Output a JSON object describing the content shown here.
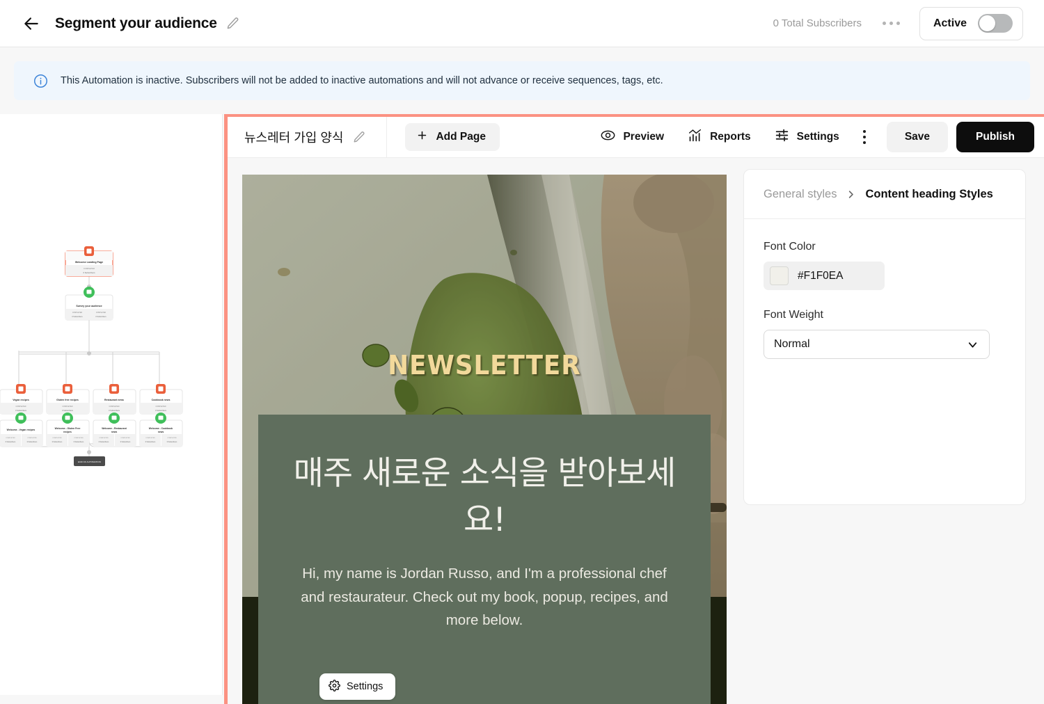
{
  "topbar": {
    "back_icon": "arrow-left-icon",
    "title": "Segment your audience",
    "edit_icon": "pencil-icon",
    "subscribers": "0 Total Subscribers",
    "more_icon": "more-horizontal-icon",
    "toggle_label": "Active",
    "toggle_on": false
  },
  "banner": {
    "icon": "info-icon",
    "text": "This Automation is inactive. Subscribers will not be added to inactive automations and will not advance or receive sequences, tags, etc.",
    "bg": "#eff6fd",
    "accent": "#3b83d8"
  },
  "flow": {
    "nodes": [
      {
        "label": "Welcome Landing Page",
        "meta1": "COMPLETED",
        "meta2": "0 Subscribers",
        "kind": "page",
        "selected": true
      },
      {
        "label": "Survey your audience",
        "meta1": "COMPLETED",
        "meta2": "0 Subscribers",
        "kind": "survey"
      },
      {
        "label": "Vegan recipes",
        "meta1": "COMPLETED",
        "meta2": "0 Subscribers",
        "kind": "page"
      },
      {
        "label": "Gluten free recipes",
        "meta1": "COMPLETED",
        "meta2": "0 Subscribers",
        "kind": "page"
      },
      {
        "label": "Restaurant news",
        "meta1": "COMPLETED",
        "meta2": "0 Subscribers",
        "kind": "page"
      },
      {
        "label": "Cookbook news",
        "meta1": "COMPLETED",
        "meta2": "0 Subscribers",
        "kind": "page"
      },
      {
        "label": "Welcome - Vegan recipes",
        "meta1": "COMPLETED",
        "meta2": "0 Subscribers",
        "kind": "email"
      },
      {
        "label": "Welcome - Gluten Free recipes",
        "meta1": "COMPLETED",
        "meta2": "0 Subscribers",
        "kind": "email"
      },
      {
        "label": "Welcome - Restaurant news",
        "meta1": "COMPLETED",
        "meta2": "0 Subscribers",
        "kind": "email"
      },
      {
        "label": "Welcome - Cookbook news",
        "meta1": "COMPLETED",
        "meta2": "0 Subscribers",
        "kind": "email"
      }
    ],
    "end_label": "END OF AUTOMATION",
    "selected_color": "#f47a5f",
    "page_icon_color": "#ea5f3b",
    "email_icon_color": "#3fbf5a"
  },
  "editor": {
    "highlight_color": "#fb9282",
    "page_name": "뉴스레터 가입 양식",
    "edit_icon": "pencil-icon",
    "add_page": {
      "label": "Add Page",
      "icon": "plus-icon"
    },
    "tools": [
      {
        "label": "Preview",
        "icon": "eye-icon"
      },
      {
        "label": "Reports",
        "icon": "bar-chart-icon"
      },
      {
        "label": "Settings",
        "icon": "sliders-icon"
      }
    ],
    "more_icon": "more-vertical-icon",
    "save_label": "Save",
    "publish_label": "Publish"
  },
  "preview": {
    "hero_word": "NEWSLETTER",
    "hero_word_color": "#f2d99b",
    "heading": "매주 새로운 소식을 받아보세요!",
    "body": "Hi, my name is Jordan Russo, and I'm a professional chef and restaurateur. Check out my book, popup, recipes, and more below.",
    "card_bg": "#5f6e5d",
    "band_bg": "#1d2110",
    "settings_chip": {
      "label": "Settings",
      "icon": "gear-icon"
    }
  },
  "style_panel": {
    "breadcrumb_parent": "General styles",
    "breadcrumb_chevron": "chevron-right-icon",
    "breadcrumb_current": "Content heading Styles",
    "font_color_label": "Font Color",
    "font_color_value": "#F1F0EA",
    "font_weight_label": "Font Weight",
    "font_weight_value": "Normal",
    "font_weight_chevron": "chevron-down-icon"
  }
}
